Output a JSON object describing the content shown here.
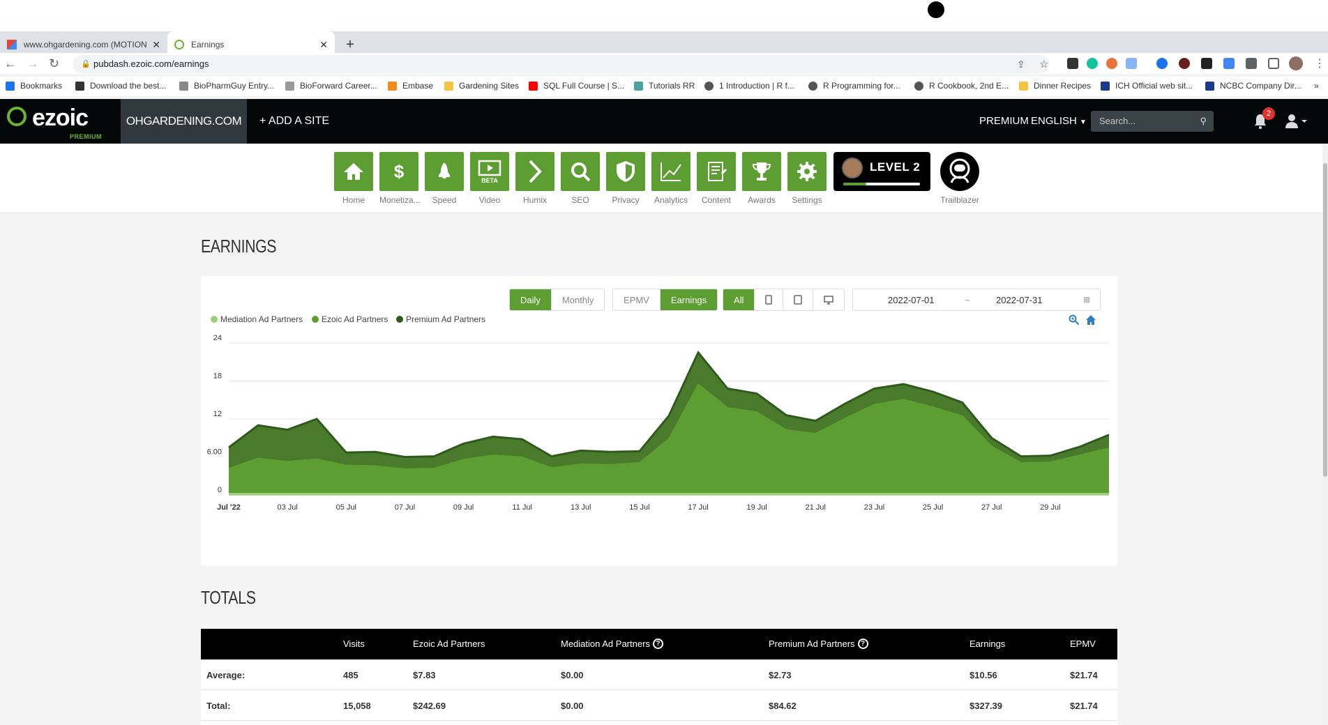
{
  "browser": {
    "tabs": [
      {
        "title": "www.ohgardening.com (MOTION",
        "active": false
      },
      {
        "title": "Earnings",
        "active": true
      }
    ],
    "url": "pubdash.ezoic.com/earnings",
    "bookmarks": [
      {
        "label": "Bookmarks",
        "color": "#1a73e8"
      },
      {
        "label": "Download the best...",
        "color": "#333333"
      },
      {
        "label": "BioPharmGuy Entry...",
        "color": "#888888"
      },
      {
        "label": "BioForward Career...",
        "color": "#999999"
      },
      {
        "label": "Embase",
        "color": "#f08c1e"
      },
      {
        "label": "Gardening Sites",
        "color": "#f5c542"
      },
      {
        "label": "SQL Full Course | S...",
        "color": "#ff0000"
      },
      {
        "label": "Tutorials RR",
        "color": "#4aa3a3"
      },
      {
        "label": "1 Introduction | R f...",
        "color": "#555555"
      },
      {
        "label": "R Programming for...",
        "color": "#555555"
      },
      {
        "label": "R Cookbook, 2nd E...",
        "color": "#555555"
      },
      {
        "label": "Dinner Recipes",
        "color": "#f5c542"
      },
      {
        "label": "ICH Official web sit...",
        "color": "#1b3a8c"
      },
      {
        "label": "NCBC Company Dir...",
        "color": "#1b3a8c"
      }
    ]
  },
  "header": {
    "logo": "ezoic",
    "logo_sub": "PREMIUM",
    "site": "OHGARDENING.COM",
    "add_site": "+ ADD A SITE",
    "premium": "PREMIUM",
    "language": "ENGLISH",
    "search_placeholder": "Search...",
    "notifications": "2"
  },
  "nav": {
    "items": [
      {
        "label": "Home",
        "icon": "home-icon"
      },
      {
        "label": "Monetiza...",
        "icon": "dollar-icon"
      },
      {
        "label": "Speed",
        "icon": "rocket-icon"
      },
      {
        "label": "Video",
        "icon": "video-icon",
        "badge": "BETA"
      },
      {
        "label": "Humix",
        "icon": "chevron-icon"
      },
      {
        "label": "SEO",
        "icon": "magnifier-icon"
      },
      {
        "label": "Privacy",
        "icon": "shield-icon"
      },
      {
        "label": "Analytics",
        "icon": "line-chart-icon"
      },
      {
        "label": "Content",
        "icon": "document-icon"
      },
      {
        "label": "Awards",
        "icon": "trophy-icon"
      },
      {
        "label": "Settings",
        "icon": "gear-icon"
      }
    ],
    "level": "LEVEL 2",
    "level_progress": 0.3,
    "trailblazer": "Trailblazer"
  },
  "earnings": {
    "title": "EARNINGS",
    "period_buttons": [
      "Daily",
      "Monthly"
    ],
    "metric_buttons": [
      "EPMV",
      "Earnings"
    ],
    "device_buttons": [
      "All"
    ],
    "date_from": "2022-07-01",
    "date_sep": "~",
    "date_to": "2022-07-31"
  },
  "chart_data": {
    "type": "area",
    "stacked": true,
    "legend_position": "top-left",
    "grid": true,
    "ylim": [
      0,
      24
    ],
    "y_ticks": [
      "0",
      "6.00",
      "12",
      "18",
      "24"
    ],
    "x_ticks": [
      "Jul '22",
      "03 Jul",
      "05 Jul",
      "07 Jul",
      "09 Jul",
      "11 Jul",
      "13 Jul",
      "15 Jul",
      "17 Jul",
      "19 Jul",
      "21 Jul",
      "23 Jul",
      "25 Jul",
      "27 Jul",
      "29 Jul"
    ],
    "x": [
      1,
      2,
      3,
      4,
      5,
      6,
      7,
      8,
      9,
      10,
      11,
      12,
      13,
      14,
      15,
      16,
      17,
      18,
      19,
      20,
      21,
      22,
      23,
      24,
      25,
      26,
      27,
      28,
      29,
      30,
      31
    ],
    "series": [
      {
        "name": "Mediation Ad Partners",
        "color": "#9ccf7a",
        "values": [
          0,
          0,
          0,
          0,
          0,
          0,
          0,
          0,
          0,
          0,
          0,
          0,
          0,
          0,
          0,
          0,
          0,
          0,
          0,
          0,
          0,
          0,
          0,
          0,
          0,
          0,
          0,
          0,
          0,
          0,
          0
        ]
      },
      {
        "name": "Ezoic Ad Partners",
        "color": "#5c9e31",
        "values": [
          4.2,
          5.8,
          5.3,
          5.7,
          4.7,
          4.6,
          4.1,
          4.2,
          5.6,
          6.3,
          6.0,
          4.3,
          4.9,
          4.8,
          5.1,
          8.9,
          17.5,
          13.8,
          13.1,
          10.3,
          9.7,
          12.1,
          14.3,
          15.1,
          13.9,
          12.5,
          7.7,
          5.1,
          5.2,
          6.3,
          7.4
        ]
      },
      {
        "name": "Premium Ad Partners",
        "color": "#3b6b24",
        "values": [
          3.3,
          5.2,
          5.0,
          6.3,
          2.0,
          2.2,
          1.9,
          1.9,
          2.5,
          2.9,
          2.8,
          1.8,
          2.1,
          2.0,
          1.8,
          3.6,
          5.0,
          3.0,
          2.9,
          2.3,
          2.0,
          2.3,
          2.5,
          2.4,
          2.4,
          2.1,
          1.3,
          1.0,
          1.0,
          1.3,
          2.1
        ]
      }
    ]
  },
  "totals": {
    "title": "TOTALS",
    "columns": [
      "Visits",
      "Ezoic Ad Partners",
      "Mediation Ad Partners",
      "Premium Ad Partners",
      "Earnings",
      "EPMV"
    ],
    "rows": [
      {
        "label": "Average:",
        "cells": [
          "485",
          "$7.83",
          "$0.00",
          "$2.73",
          "$10.56",
          "$21.74"
        ]
      },
      {
        "label": "Total:",
        "cells": [
          "15,058",
          "$242.69",
          "$0.00",
          "$84.62",
          "$327.39",
          "$21.74"
        ]
      }
    ]
  }
}
